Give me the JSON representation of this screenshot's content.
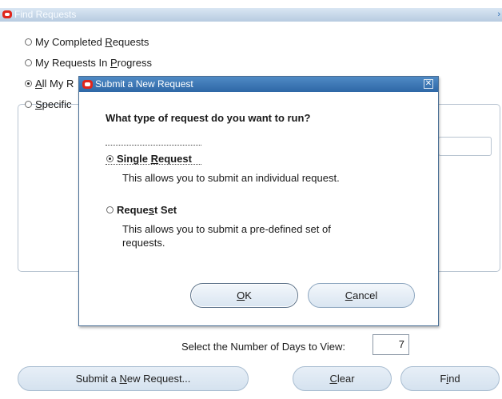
{
  "window": {
    "title": "Find Requests"
  },
  "options": [
    {
      "label_pre": "My Completed ",
      "label_key": "R",
      "label_post": "equests",
      "checked": false
    },
    {
      "label_pre": "My Requests In ",
      "label_key": "P",
      "label_post": "rogress",
      "checked": false
    },
    {
      "label_pre": "",
      "label_key": "A",
      "label_post": "ll My R",
      "checked": true
    },
    {
      "label_pre": "",
      "label_key": "S",
      "label_post": "pecific",
      "checked": false
    }
  ],
  "days": {
    "label": "Select the Number of Days to View:",
    "value": "7"
  },
  "buttons": {
    "submit_pre": "Submit a ",
    "submit_key": "N",
    "submit_post": "ew Request...",
    "clear_key": "C",
    "clear_post": "lear",
    "find_pre": "F",
    "find_key": "i",
    "find_post": "nd"
  },
  "dialog": {
    "title": "Submit a New Request",
    "close_glyph": "✕",
    "question": "What type of request do you want to run?",
    "single_label_pre": "Single ",
    "single_label_key": "R",
    "single_label_post": "equest",
    "single_desc": "This allows you to submit an individual request.",
    "set_label_pre": "Reque",
    "set_label_key": "s",
    "set_label_post": "t Set",
    "set_desc": "This allows you to submit a pre-defined set of requests.",
    "ok_key": "O",
    "ok_post": "K",
    "cancel_key": "C",
    "cancel_post": "ancel",
    "selected": "single"
  }
}
